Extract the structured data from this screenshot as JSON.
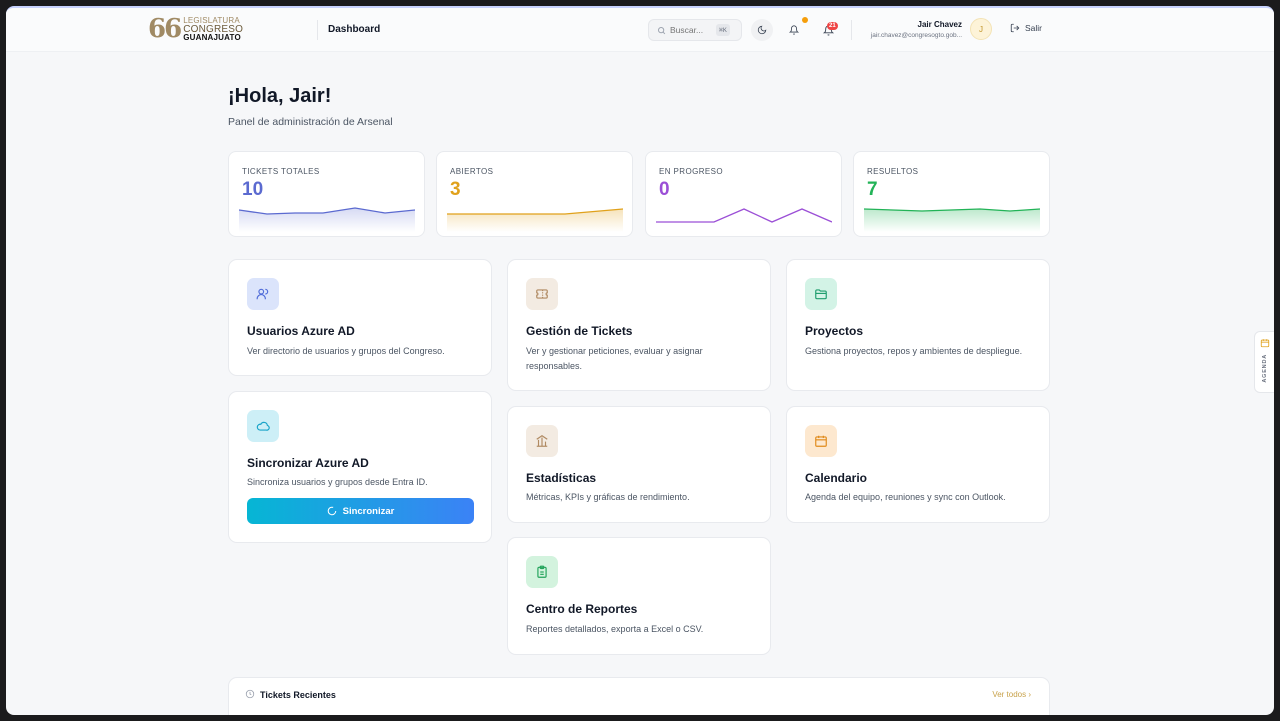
{
  "header": {
    "logo": {
      "number": "66",
      "line1": "LEGISLATURA",
      "line2": "CONGRESO",
      "line3": "GUANAJUATO"
    },
    "title": "Dashboard",
    "search": {
      "placeholder": "Buscar...",
      "shortcut": "⌘K"
    },
    "notification_badge": "21",
    "user": {
      "name": "Jair Chavez",
      "email": "jair.chavez@congresogto.gob...",
      "initial": "J"
    },
    "logout_label": "Salir"
  },
  "greeting": "¡Hola, Jair!",
  "subtitle": "Panel de administración de Arsenal",
  "stats": [
    {
      "label": "TICKETS TOTALES",
      "value": "10",
      "color": "#5b6ad0"
    },
    {
      "label": "ABIERTOS",
      "value": "3",
      "color": "#e0a11b"
    },
    {
      "label": "EN PROGRESO",
      "value": "0",
      "color": "#9b4fd6"
    },
    {
      "label": "RESUELTOS",
      "value": "7",
      "color": "#22b357"
    }
  ],
  "cards": {
    "usuarios": {
      "title": "Usuarios Azure AD",
      "desc": "Ver directorio de usuarios y grupos del Congreso."
    },
    "tickets": {
      "title": "Gestión de Tickets",
      "desc": "Ver y gestionar peticiones, evaluar y asignar responsables."
    },
    "proyectos": {
      "title": "Proyectos",
      "desc": "Gestiona proyectos, repos y ambientes de despliegue."
    },
    "sincronizar": {
      "title": "Sincronizar Azure AD",
      "desc": "Sincroniza usuarios y grupos desde Entra ID.",
      "button": "Sincronizar"
    },
    "estadisticas": {
      "title": "Estadísticas",
      "desc": "Métricas, KPIs y gráficas de rendimiento."
    },
    "calendario": {
      "title": "Calendario",
      "desc": "Agenda del equipo, reuniones y sync con Outlook."
    },
    "reportes": {
      "title": "Centro de Reportes",
      "desc": "Reportes detallados, exporta a Excel o CSV."
    }
  },
  "recent": {
    "title": "Tickets Recientes",
    "link": "Ver todos ›"
  },
  "agenda_tab": "AGENDA"
}
